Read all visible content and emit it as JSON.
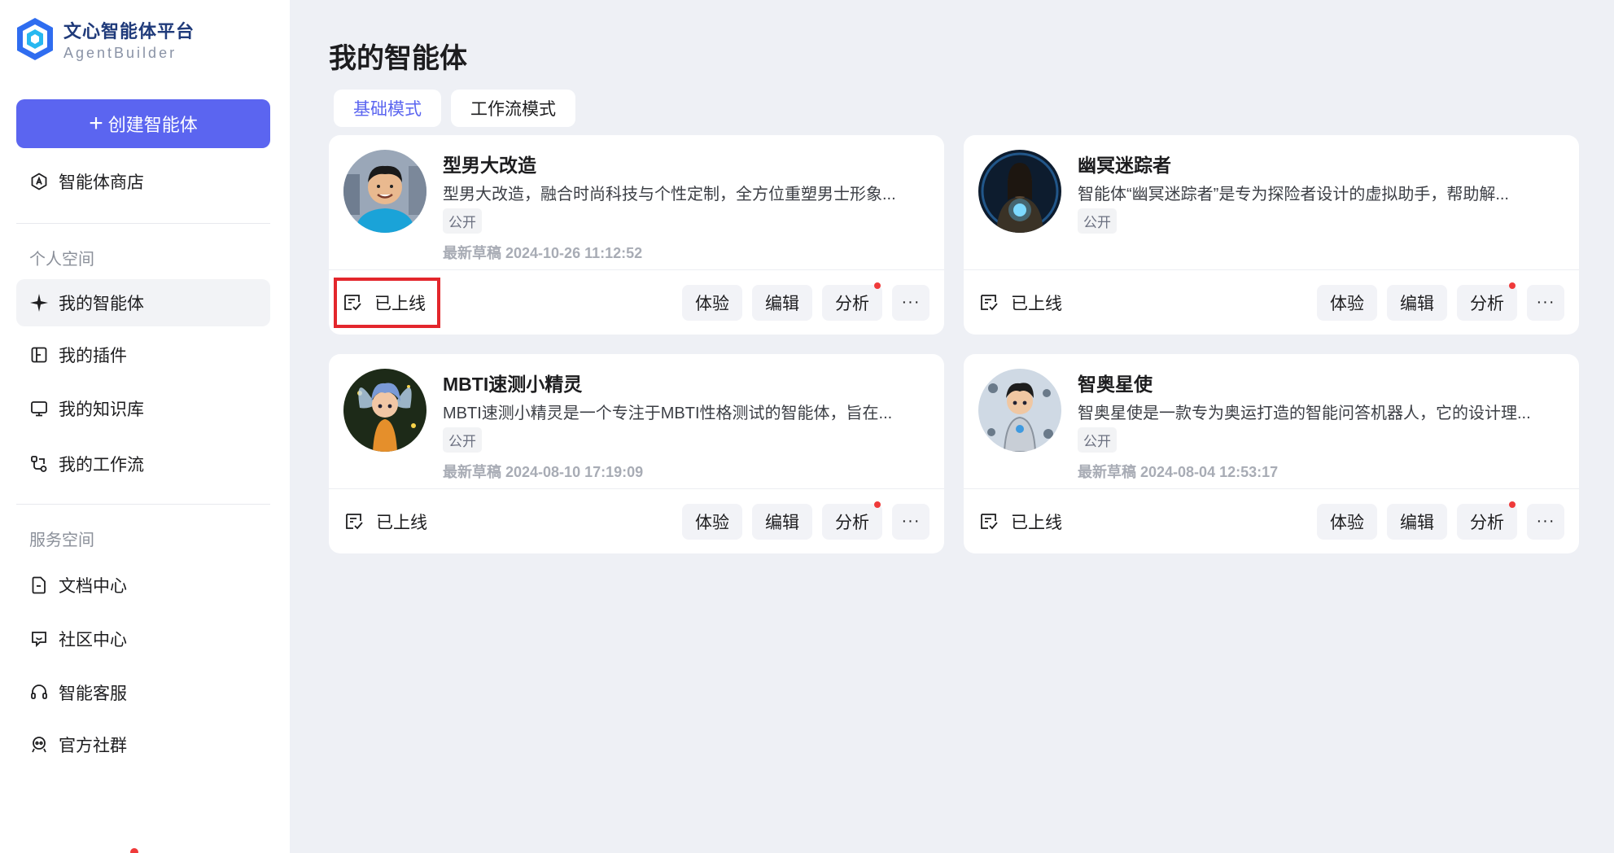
{
  "app": {
    "logo_title": "文心智能体平台",
    "logo_sub": "AgentBuilder"
  },
  "sidebar": {
    "create_label": "创建智能体",
    "store_label": "智能体商店",
    "personal_section": "个人空间",
    "personal_items": [
      {
        "label": "我的智能体",
        "icon": "sparkle-icon",
        "active": true
      },
      {
        "label": "我的插件",
        "icon": "plugin-icon",
        "active": false
      },
      {
        "label": "我的知识库",
        "icon": "monitor-icon",
        "active": false
      },
      {
        "label": "我的工作流",
        "icon": "workflow-icon",
        "active": false
      }
    ],
    "service_section": "服务空间",
    "service_items": [
      {
        "label": "文档中心",
        "icon": "document-icon"
      },
      {
        "label": "社区中心",
        "icon": "chat-icon"
      },
      {
        "label": "智能客服",
        "icon": "headset-icon"
      },
      {
        "label": "官方社群",
        "icon": "community-icon"
      }
    ]
  },
  "main": {
    "title": "我的智能体",
    "tabs": [
      {
        "label": "基础模式",
        "active": true
      },
      {
        "label": "工作流模式",
        "active": false
      }
    ],
    "cards": [
      {
        "name": "型男大改造",
        "desc": "型男大改造，融合时尚科技与个性定制，全方位重塑男士形象...",
        "badge": "公开",
        "draft": "最新草稿 2024-10-26 11:12:52",
        "status": "已上线",
        "avatar": "avatar-man-blue-shirt"
      },
      {
        "name": "幽冥迷踪者",
        "desc": "智能体“幽冥迷踪者”是专为探险者设计的虚拟助手，帮助解...",
        "badge": "公开",
        "draft": "",
        "status": "已上线",
        "avatar": "avatar-dark-mystic"
      },
      {
        "name": "MBTI速测小精灵",
        "desc": "MBTI速测小精灵是一个专注于MBTI性格测试的智能体，旨在...",
        "badge": "公开",
        "draft": "最新草稿 2024-08-10 17:19:09",
        "status": "已上线",
        "avatar": "avatar-fairy"
      },
      {
        "name": "智奥星使",
        "desc": "智奥星使是一款专为奥运打造的智能问答机器人，它的设计理...",
        "badge": "公开",
        "draft": "最新草稿 2024-08-04 12:53:17",
        "status": "已上线",
        "avatar": "avatar-robot-boy"
      }
    ],
    "actions": {
      "try": "体验",
      "edit": "编辑",
      "analyze": "分析",
      "more": "···"
    }
  },
  "colors": {
    "accent": "#5b65f0",
    "highlight": "#e3262c",
    "notify_dot": "#ef3a3a"
  }
}
